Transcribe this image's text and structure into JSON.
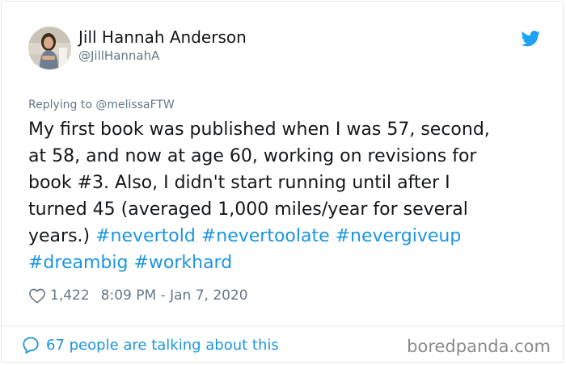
{
  "author": {
    "name": "Jill Hannah Anderson",
    "handle": "@JillHannahA"
  },
  "reply_to": "Replying to @melissaFTW",
  "tweet": {
    "lines": [
      [
        {
          "text": "My first book was published when I was 57, second,",
          "type": "text"
        }
      ],
      [
        {
          "text": "at 58, and now at age 60, working on revisions for",
          "type": "text"
        }
      ],
      [
        {
          "text": "book #3. Also, I didn't start running until after I",
          "type": "text"
        }
      ],
      [
        {
          "text": "turned 45 (averaged 1,000 miles/year for several",
          "type": "text"
        }
      ],
      [
        {
          "text": "years.) ",
          "type": "text"
        },
        {
          "text": "#nevertold",
          "type": "hashtag"
        },
        {
          "text": " ",
          "type": "text"
        },
        {
          "text": "#nevertoolate",
          "type": "hashtag"
        },
        {
          "text": " ",
          "type": "text"
        },
        {
          "text": "#nevergiveup",
          "type": "hashtag"
        }
      ],
      [
        {
          "text": "#dreambig",
          "type": "hashtag"
        },
        {
          "text": " ",
          "type": "text"
        },
        {
          "text": "#workhard",
          "type": "hashtag"
        }
      ]
    ]
  },
  "meta": {
    "likes": "1,422",
    "timestamp": "8:09 PM - Jan 7, 2020"
  },
  "footer": {
    "talking": "67 people are talking about this",
    "watermark": "boredpanda.com"
  },
  "icons": {
    "logo": "twitter-bird-icon",
    "like": "heart-icon",
    "conversation": "speech-bubble-icon"
  },
  "colors": {
    "link": "#1b95e0",
    "muted": "#657786",
    "text": "#14171a",
    "twitter_blue": "#1da1f2"
  }
}
